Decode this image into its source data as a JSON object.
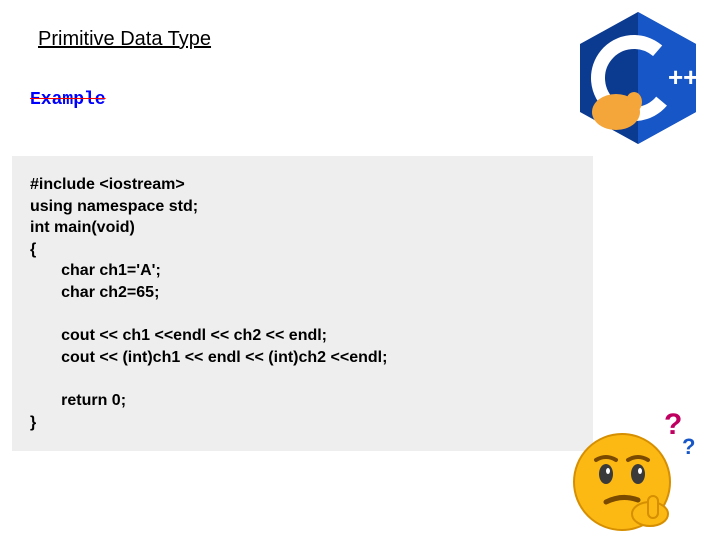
{
  "title": "Primitive Data Type",
  "example_label": "Example",
  "code": "#include <iostream>\nusing namespace std;\nint main(void)\n{\n       char ch1='A';\n       char ch2=65;\n\n       cout << ch1 <<endl << ch2 << endl;\n       cout << (int)ch1 << endl << (int)ch2 <<endl;\n\n       return 0;\n}",
  "logo_text": "++",
  "icons": {
    "cpp_logo": "cpp-logo-thinking",
    "thinking_face": "thinking-emoji-question"
  }
}
